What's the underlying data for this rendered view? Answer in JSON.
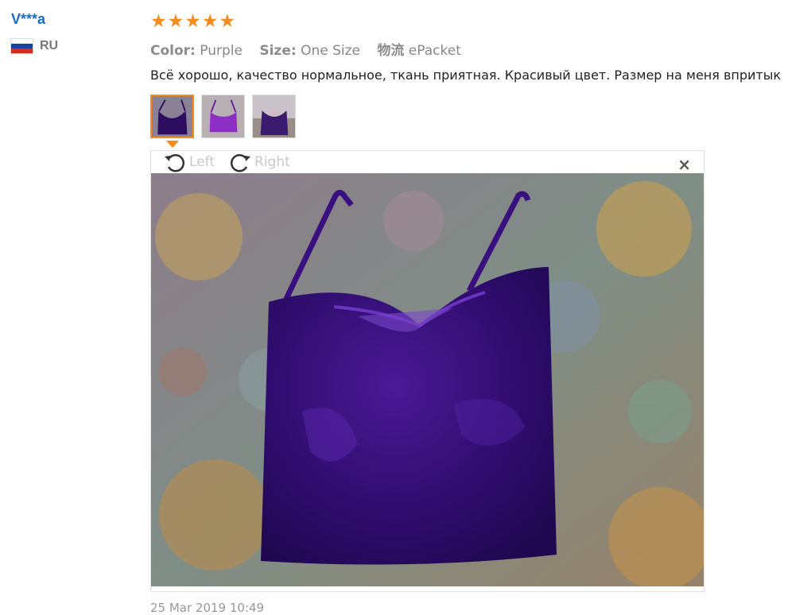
{
  "user": {
    "name": "V***a",
    "country": "RU"
  },
  "review": {
    "rating": 5,
    "meta": [
      {
        "key": "Color:",
        "value": "Purple"
      },
      {
        "key": "Size:",
        "value": "One Size"
      },
      {
        "key": "物流",
        "value": "ePacket"
      }
    ],
    "text": "Всё хорошо, качество нормальное, ткань приятная. Красивый цвет. Размер на меня впритык",
    "date": "25 Mar 2019 10:49"
  },
  "viewer": {
    "rotate_left_label": "Left",
    "rotate_right_label": "Right",
    "close_label": "×"
  },
  "colors": {
    "star": "#f68d1e",
    "username": "#1a6cc4",
    "active_border": "#f68d1e"
  }
}
